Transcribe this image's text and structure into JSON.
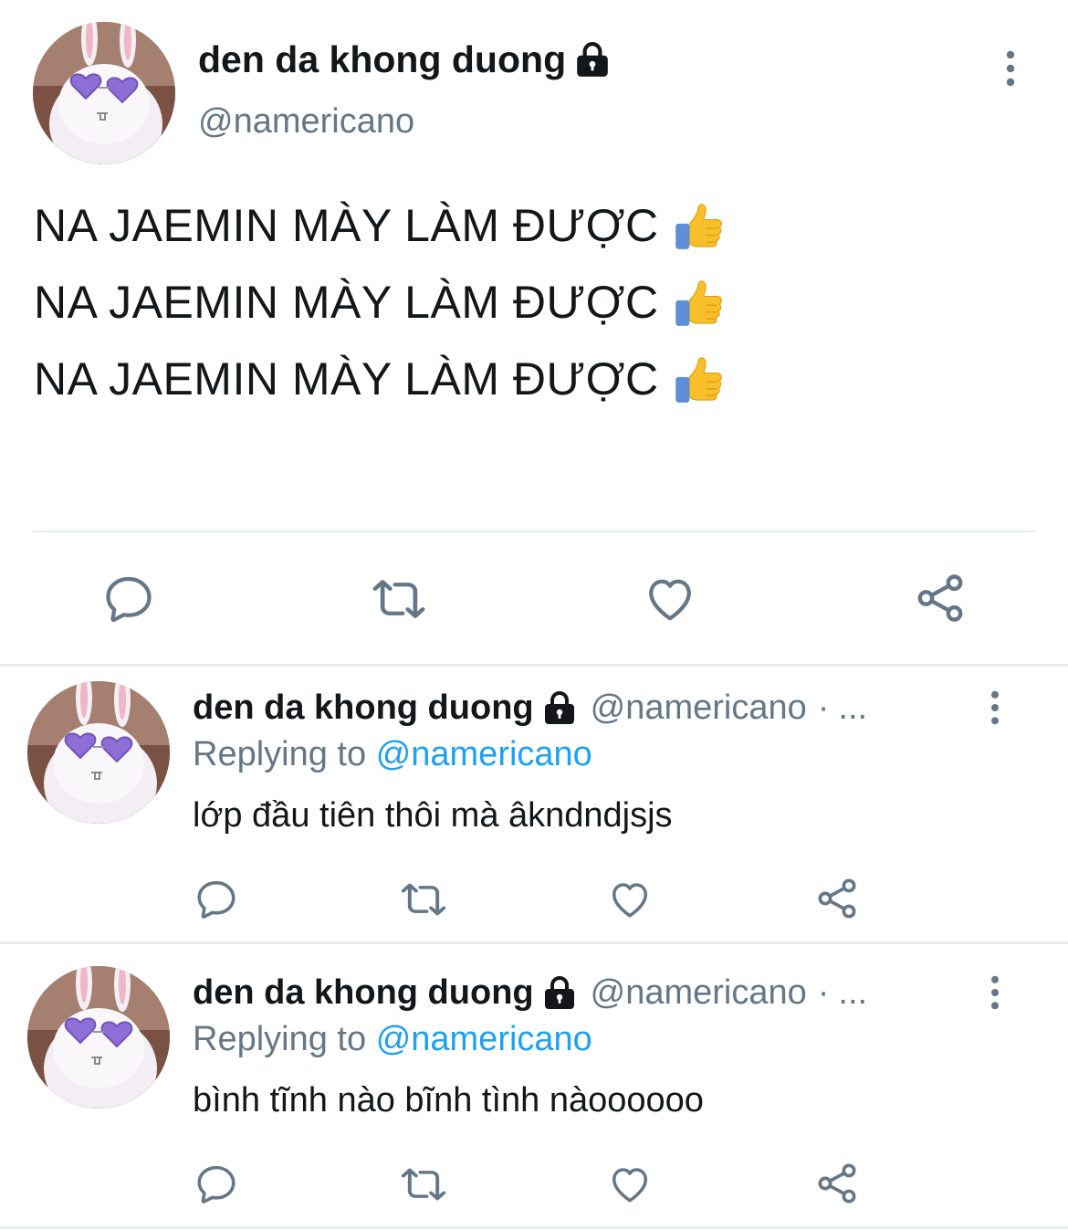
{
  "main_tweet": {
    "display_name": "den da khong duong",
    "handle": "@namericano",
    "lines": [
      "NA JAEMIN MÀY LÀM ĐƯỢC",
      "NA JAEMIN MÀY LÀM ĐƯỢC",
      "NA JAEMIN MÀY LÀM ĐƯỢC"
    ],
    "emoji": "thumbs-up",
    "icons": [
      "more-vertical-icon",
      "lock-icon",
      "reply-icon",
      "retweet-icon",
      "like-icon",
      "share-icon"
    ]
  },
  "replies": [
    {
      "display_name": "den da khong duong",
      "handle": "@namericano",
      "separator": "·",
      "time": "...",
      "replying_label": "Replying to",
      "replying_to": "@namericano",
      "text": "lớp đầu tiên thôi mà âkndndjsjs"
    },
    {
      "display_name": "den da khong duong",
      "handle": "@namericano",
      "separator": "·",
      "time": "...",
      "replying_label": "Replying to",
      "replying_to": "@namericano",
      "text": "bình tĩnh nào bĩnh tình nàoooooo"
    }
  ],
  "colors": {
    "text_primary": "#14171a",
    "text_secondary": "#657786",
    "link": "#1da1f2",
    "icon": "#657786",
    "divider": "#e6ecf0",
    "emoji_yellow": "#f7c02a"
  }
}
